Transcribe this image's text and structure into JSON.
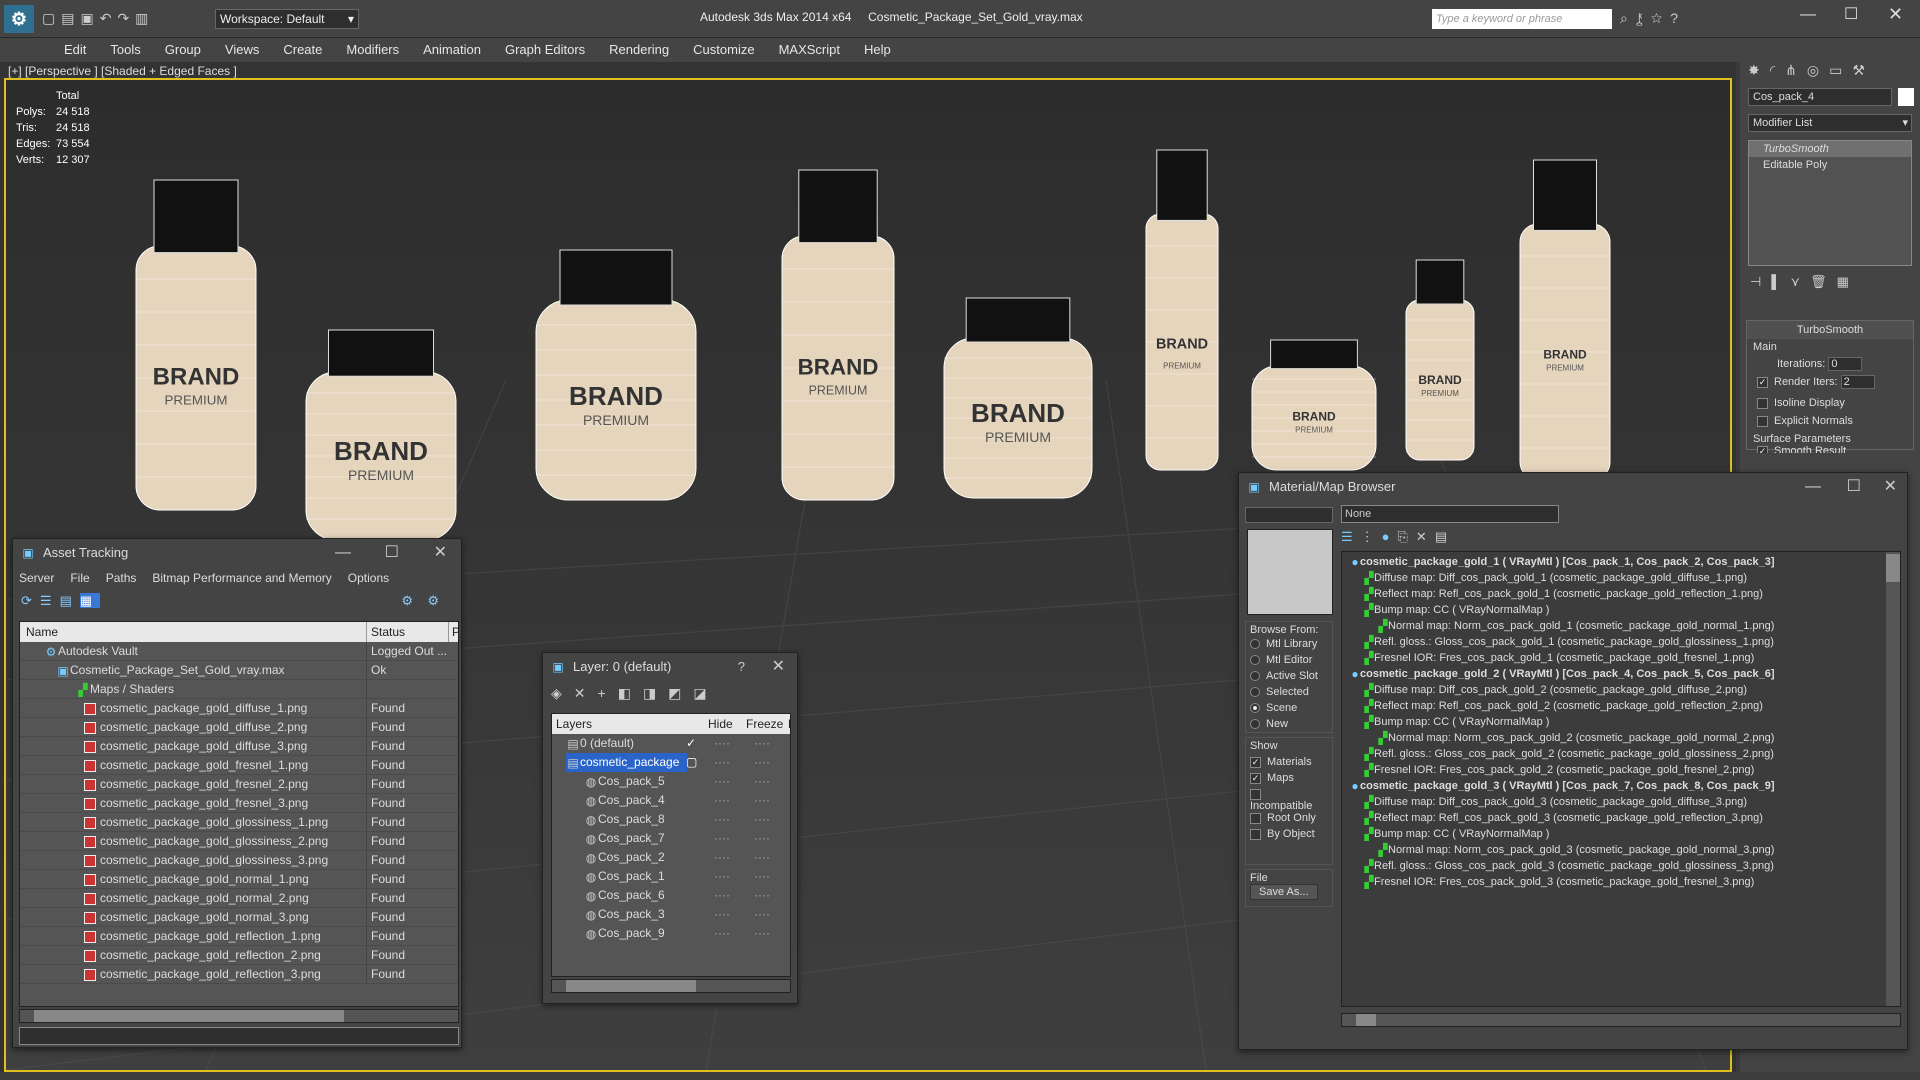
{
  "app": {
    "title": "Autodesk 3ds Max  2014 x64",
    "file": "Cosmetic_Package_Set_Gold_vray.max",
    "workspace": "Workspace: Default",
    "search_placeholder": "Type a keyword or phrase"
  },
  "menu": [
    "Edit",
    "Tools",
    "Group",
    "Views",
    "Create",
    "Modifiers",
    "Animation",
    "Graph Editors",
    "Rendering",
    "Customize",
    "MAXScript",
    "Help"
  ],
  "viewport": {
    "label": "[+] [Perspective ] [Shaded + Edged Faces ]",
    "stats": {
      "header": "Total",
      "rows": [
        {
          "k": "Polys:",
          "v": "24 518"
        },
        {
          "k": "Tris:",
          "v": "24 518"
        },
        {
          "k": "Edges:",
          "v": "73 554"
        },
        {
          "k": "Verts:",
          "v": "12 307"
        }
      ]
    },
    "brand": "BRAND",
    "premium": "PREMIUM"
  },
  "cmdpanel": {
    "object_name": "Cos_pack_4",
    "modifier_list": "Modifier List",
    "stack": [
      "TurboSmooth",
      "Editable Poly"
    ],
    "rollout": "TurboSmooth",
    "main": "Main",
    "iterations_label": "Iterations:",
    "iterations": "0",
    "render_iters_label": "Render Iters:",
    "render_iters": "2",
    "isoline": "Isoline Display",
    "explicit": "Explicit Normals",
    "surface": "Surface Parameters",
    "smooth": "Smooth Result"
  },
  "asset": {
    "title": "Asset Tracking",
    "menu": [
      "Server",
      "File",
      "Paths",
      "Bitmap Performance and Memory",
      "Options"
    ],
    "col_name": "Name",
    "col_status": "Status",
    "col_p": "P",
    "rows": [
      {
        "name": "Autodesk Vault",
        "status": "Logged Out ..."
      },
      {
        "name": "Cosmetic_Package_Set_Gold_vray.max",
        "status": "Ok"
      },
      {
        "name": "Maps / Shaders",
        "status": ""
      },
      {
        "name": "cosmetic_package_gold_diffuse_1.png",
        "status": "Found"
      },
      {
        "name": "cosmetic_package_gold_diffuse_2.png",
        "status": "Found"
      },
      {
        "name": "cosmetic_package_gold_diffuse_3.png",
        "status": "Found"
      },
      {
        "name": "cosmetic_package_gold_fresnel_1.png",
        "status": "Found"
      },
      {
        "name": "cosmetic_package_gold_fresnel_2.png",
        "status": "Found"
      },
      {
        "name": "cosmetic_package_gold_fresnel_3.png",
        "status": "Found"
      },
      {
        "name": "cosmetic_package_gold_glossiness_1.png",
        "status": "Found"
      },
      {
        "name": "cosmetic_package_gold_glossiness_2.png",
        "status": "Found"
      },
      {
        "name": "cosmetic_package_gold_glossiness_3.png",
        "status": "Found"
      },
      {
        "name": "cosmetic_package_gold_normal_1.png",
        "status": "Found"
      },
      {
        "name": "cosmetic_package_gold_normal_2.png",
        "status": "Found"
      },
      {
        "name": "cosmetic_package_gold_normal_3.png",
        "status": "Found"
      },
      {
        "name": "cosmetic_package_gold_reflection_1.png",
        "status": "Found"
      },
      {
        "name": "cosmetic_package_gold_reflection_2.png",
        "status": "Found"
      },
      {
        "name": "cosmetic_package_gold_reflection_3.png",
        "status": "Found"
      }
    ]
  },
  "layer": {
    "title": "Layer: 0 (default)",
    "col_layers": "Layers",
    "col_hide": "Hide",
    "col_freeze": "Freeze",
    "col_r": "R",
    "rows": [
      "0 (default)",
      "cosmetic_package",
      "Cos_pack_5",
      "Cos_pack_4",
      "Cos_pack_8",
      "Cos_pack_7",
      "Cos_pack_2",
      "Cos_pack_1",
      "Cos_pack_6",
      "Cos_pack_3",
      "Cos_pack_9"
    ]
  },
  "matbrowser": {
    "title": "Material/Map Browser",
    "search": "None",
    "browse_from": "Browse From:",
    "browse": [
      "Mtl Library",
      "Mtl Editor",
      "Active Slot",
      "Selected",
      "Scene",
      "New"
    ],
    "show": "Show",
    "show_items": [
      "Materials",
      "Maps",
      "Incompatible"
    ],
    "root_only": "Root Only",
    "by_object": "By Object",
    "file": "File",
    "save_as": "Save As...",
    "tree": [
      {
        "lvl": 0,
        "t": "cosmetic_package_gold_1  ( VRayMtl ) [Cos_pack_1, Cos_pack_2, Cos_pack_3]"
      },
      {
        "lvl": 1,
        "t": "Diffuse map: Diff_cos_pack_gold_1 (cosmetic_package_gold_diffuse_1.png)"
      },
      {
        "lvl": 1,
        "t": "Reflect map: Refl_cos_pack_gold_1 (cosmetic_package_gold_reflection_1.png)"
      },
      {
        "lvl": 1,
        "t": "Bump map: CC  ( VRayNormalMap )"
      },
      {
        "lvl": 2,
        "t": "Normal map: Norm_cos_pack_gold_1 (cosmetic_package_gold_normal_1.png)"
      },
      {
        "lvl": 1,
        "t": "Refl. gloss.: Gloss_cos_pack_gold_1 (cosmetic_package_gold_glossiness_1.png)"
      },
      {
        "lvl": 1,
        "t": "Fresnel IOR: Fres_cos_pack_gold_1 (cosmetic_package_gold_fresnel_1.png)"
      },
      {
        "lvl": 0,
        "t": "cosmetic_package_gold_2  ( VRayMtl ) [Cos_pack_4, Cos_pack_5, Cos_pack_6]"
      },
      {
        "lvl": 1,
        "t": "Diffuse map: Diff_cos_pack_gold_2 (cosmetic_package_gold_diffuse_2.png)"
      },
      {
        "lvl": 1,
        "t": "Reflect map: Refl_cos_pack_gold_2 (cosmetic_package_gold_reflection_2.png)"
      },
      {
        "lvl": 1,
        "t": "Bump map: CC  ( VRayNormalMap )"
      },
      {
        "lvl": 2,
        "t": "Normal map: Norm_cos_pack_gold_2 (cosmetic_package_gold_normal_2.png)"
      },
      {
        "lvl": 1,
        "t": "Refl. gloss.: Gloss_cos_pack_gold_2 (cosmetic_package_gold_glossiness_2.png)"
      },
      {
        "lvl": 1,
        "t": "Fresnel IOR: Fres_cos_pack_gold_2 (cosmetic_package_gold_fresnel_2.png)"
      },
      {
        "lvl": 0,
        "t": "cosmetic_package_gold_3  ( VRayMtl ) [Cos_pack_7, Cos_pack_8, Cos_pack_9]"
      },
      {
        "lvl": 1,
        "t": "Diffuse map: Diff_cos_pack_gold_3 (cosmetic_package_gold_diffuse_3.png)"
      },
      {
        "lvl": 1,
        "t": "Reflect map: Refl_cos_pack_gold_3 (cosmetic_package_gold_reflection_3.png)"
      },
      {
        "lvl": 1,
        "t": "Bump map: CC  ( VRayNormalMap )"
      },
      {
        "lvl": 2,
        "t": "Normal map: Norm_cos_pack_gold_3 (cosmetic_package_gold_normal_3.png)"
      },
      {
        "lvl": 1,
        "t": "Refl. gloss.: Gloss_cos_pack_gold_3 (cosmetic_package_gold_glossiness_3.png)"
      },
      {
        "lvl": 1,
        "t": "Fresnel IOR: Fres_cos_pack_gold_3 (cosmetic_package_gold_fresnel_3.png)"
      }
    ]
  },
  "colors": {
    "accent": "#3a78d8",
    "selected": "#2a64c8",
    "frame_yellow": "#e0c020",
    "object_fill": "#e6d5bd"
  }
}
